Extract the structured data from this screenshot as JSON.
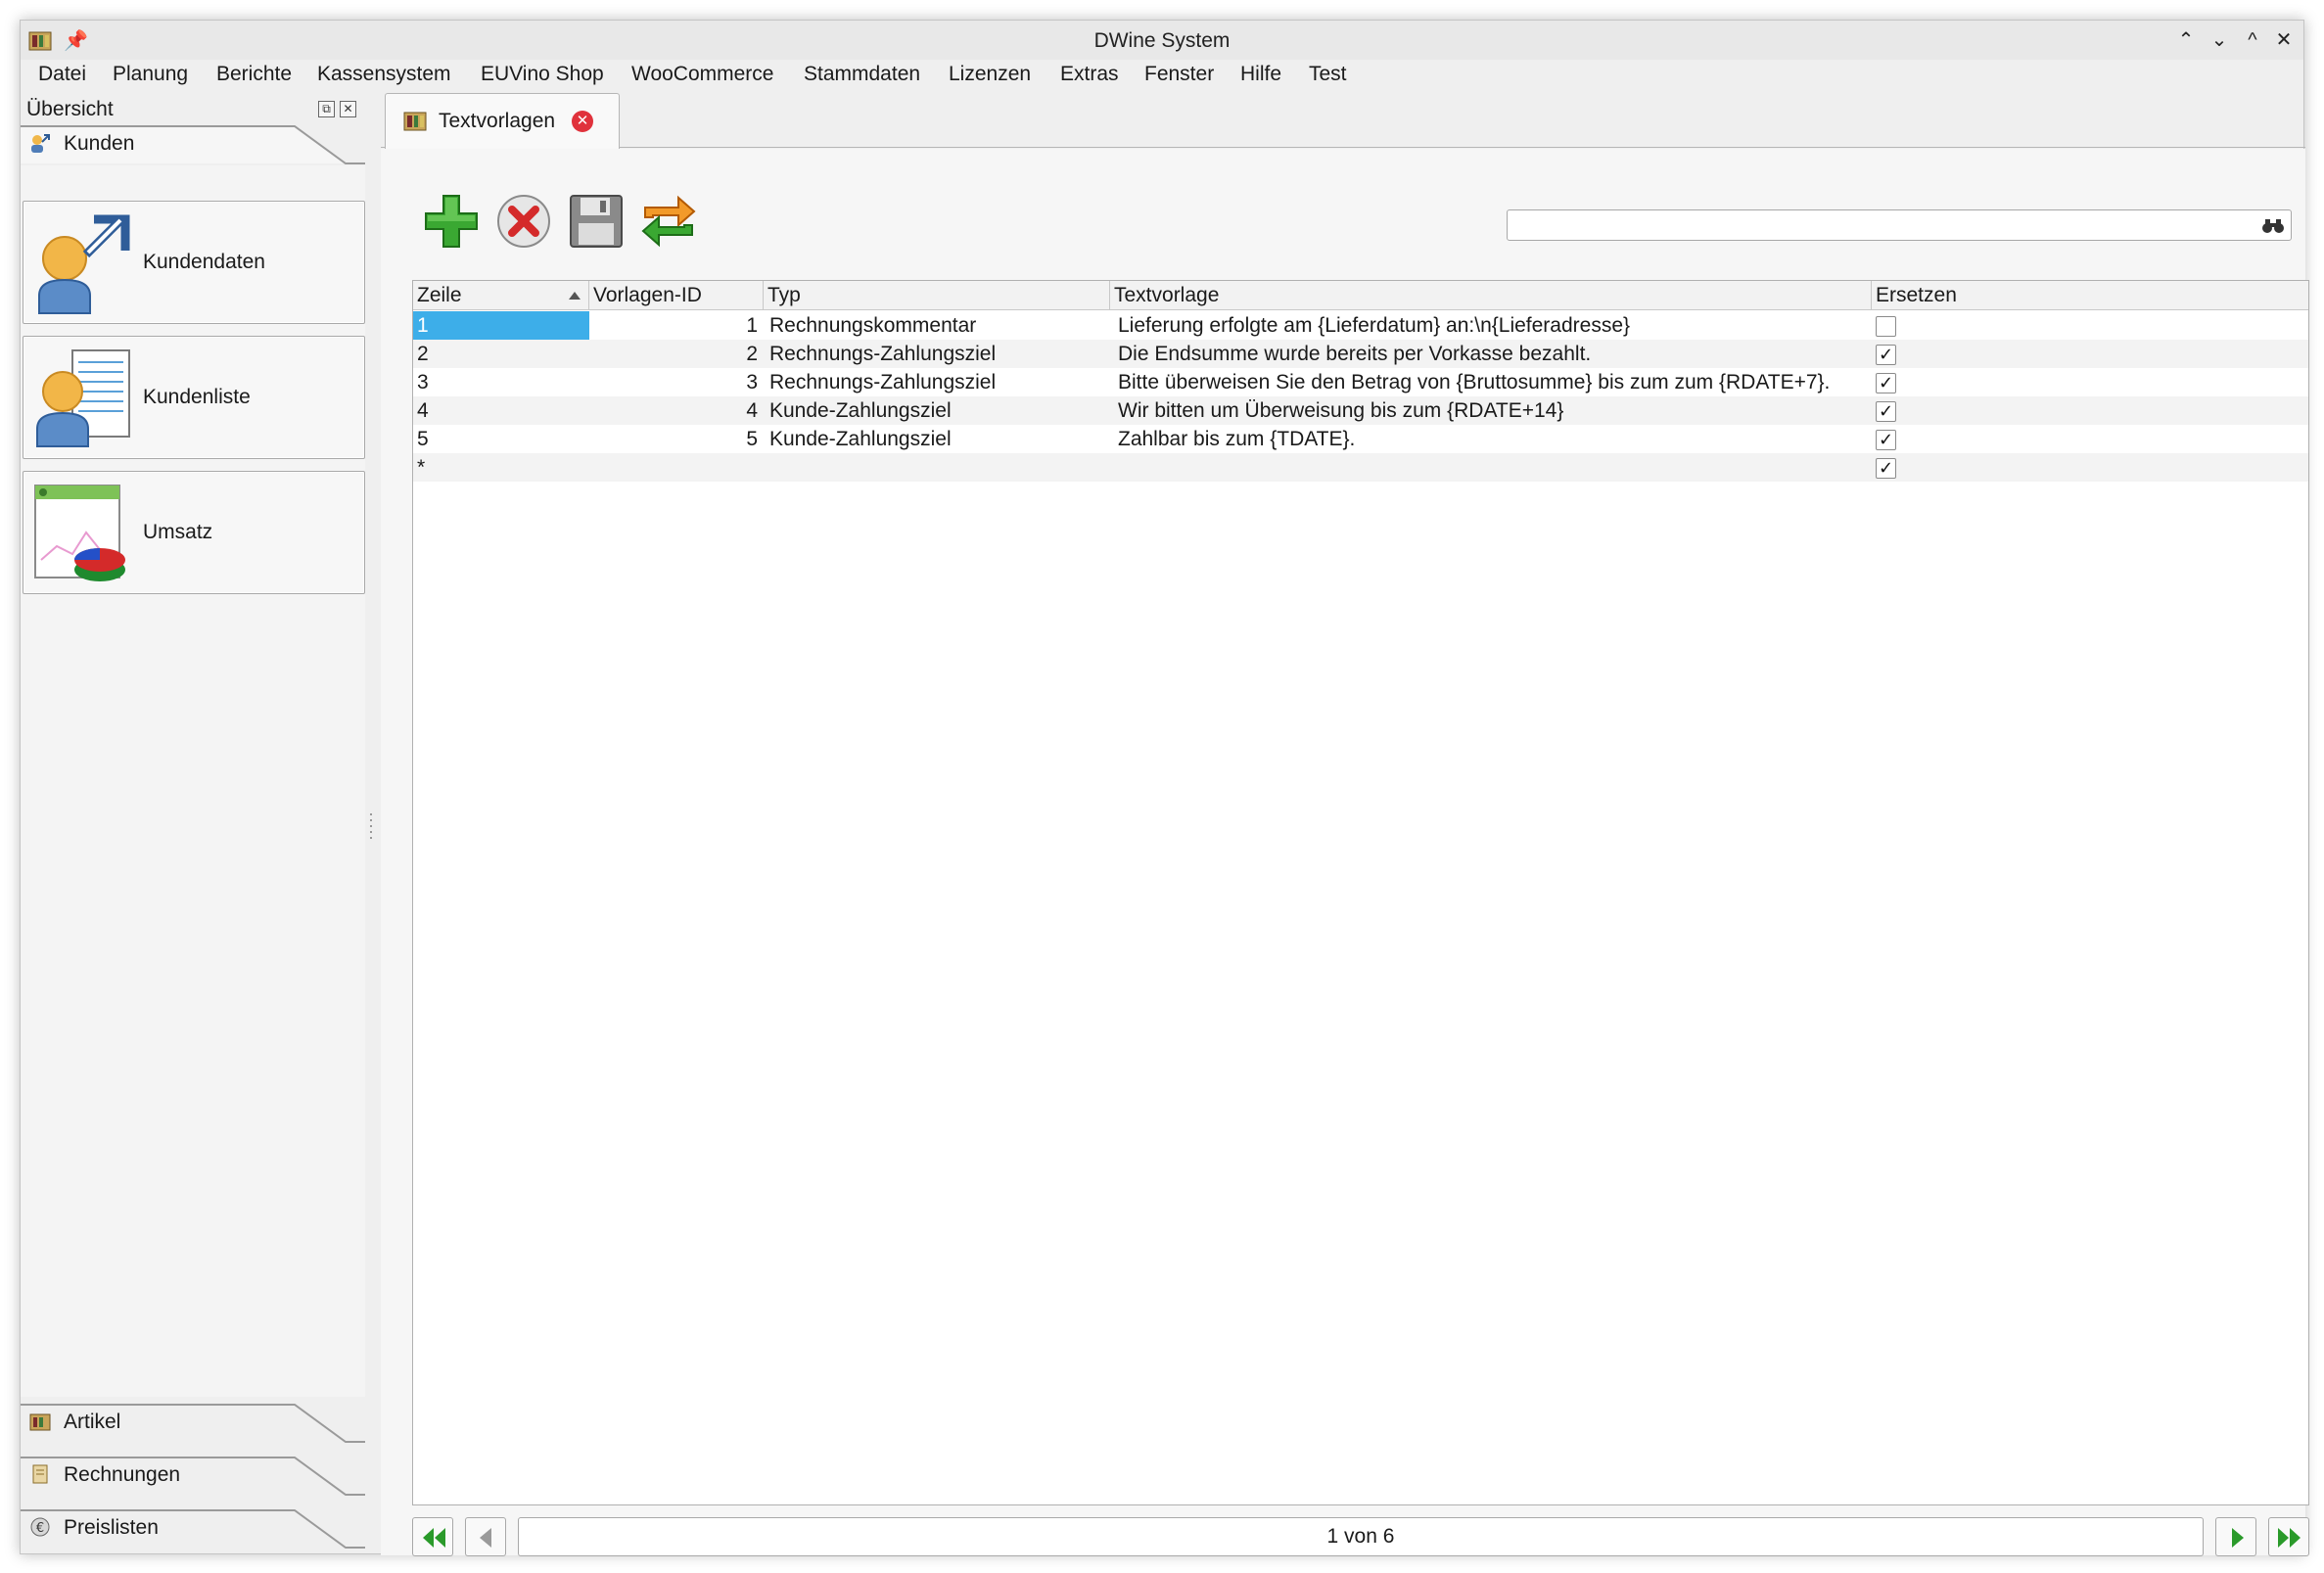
{
  "window": {
    "title": "DWine System",
    "controls": [
      "⌃",
      "⌄",
      "^",
      "✕"
    ]
  },
  "menu": [
    "Datei",
    "Planung",
    "Berichte",
    "Kassensystem",
    "EUVino Shop",
    "WooCommerce",
    "Stammdaten",
    "Lizenzen",
    "Extras",
    "Fenster",
    "Hilfe",
    "Test"
  ],
  "sidebar": {
    "header": "Übersicht",
    "active_section": "Kunden",
    "cards": [
      {
        "label": "Kundendaten",
        "icon": "customer-arrow-icon"
      },
      {
        "label": "Kundenliste",
        "icon": "customer-list-icon"
      },
      {
        "label": "Umsatz",
        "icon": "sales-chart-icon"
      }
    ],
    "bottom_sections": [
      "Artikel",
      "Rechnungen",
      "Preislisten"
    ]
  },
  "tab": {
    "label": "Textvorlagen"
  },
  "toolbar": {
    "buttons": [
      "add-icon",
      "delete-icon",
      "save-icon",
      "refresh-icon"
    ],
    "search_value": ""
  },
  "grid": {
    "columns": [
      "Zeile",
      "Vorlagen-ID",
      "Typ",
      "Textvorlage",
      "Ersetzen"
    ],
    "rows": [
      {
        "zeile": "1",
        "id": "1",
        "typ": "Rechnungskommentar",
        "text": "Lieferung erfolgte am {Lieferdatum} an:\\n{Lieferadresse}",
        "ersetzen": false
      },
      {
        "zeile": "2",
        "id": "2",
        "typ": "Rechnungs-Zahlungsziel",
        "text": "Die Endsumme wurde bereits per Vorkasse bezahlt.",
        "ersetzen": true
      },
      {
        "zeile": "3",
        "id": "3",
        "typ": "Rechnungs-Zahlungsziel",
        "text": "Bitte überweisen Sie den Betrag von {Bruttosumme} bis zum zum {RDATE+7}.",
        "ersetzen": true
      },
      {
        "zeile": "4",
        "id": "4",
        "typ": "Kunde-Zahlungsziel",
        "text": "Wir bitten um Überweisung bis zum {RDATE+14}",
        "ersetzen": true
      },
      {
        "zeile": "5",
        "id": "5",
        "typ": "Kunde-Zahlungsziel",
        "text": "Zahlbar bis zum {TDATE}.",
        "ersetzen": true
      },
      {
        "zeile": "*",
        "id": "",
        "typ": "",
        "text": "",
        "ersetzen": true
      }
    ],
    "check_glyph": "✓"
  },
  "pager": {
    "indicator": "1 von 6"
  }
}
